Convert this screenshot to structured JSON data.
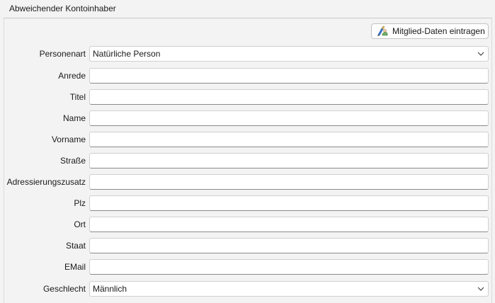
{
  "section": {
    "title": "Abweichender Kontoinhaber"
  },
  "toolbar": {
    "fill_member_label": "Mitglied-Daten eintragen",
    "fill_member_icon": "member-data-icon"
  },
  "form": {
    "personenart": {
      "label": "Personenart",
      "value": "Natürliche Person"
    },
    "anrede": {
      "label": "Anrede",
      "value": ""
    },
    "titel": {
      "label": "Titel",
      "value": ""
    },
    "name": {
      "label": "Name",
      "value": ""
    },
    "vorname": {
      "label": "Vorname",
      "value": ""
    },
    "strasse": {
      "label": "Straße",
      "value": ""
    },
    "adressierungszusatz": {
      "label": "Adressierungszusatz",
      "value": ""
    },
    "plz": {
      "label": "Plz",
      "value": ""
    },
    "ort": {
      "label": "Ort",
      "value": ""
    },
    "staat": {
      "label": "Staat",
      "value": ""
    },
    "email": {
      "label": "EMail",
      "value": ""
    },
    "geschlecht": {
      "label": "Geschlecht",
      "value": "Männlich"
    }
  },
  "colors": {
    "background": "#f3f3f3",
    "field_background": "#ffffff",
    "field_border": "#d0d0d0",
    "field_underline": "#8a8a8a"
  }
}
